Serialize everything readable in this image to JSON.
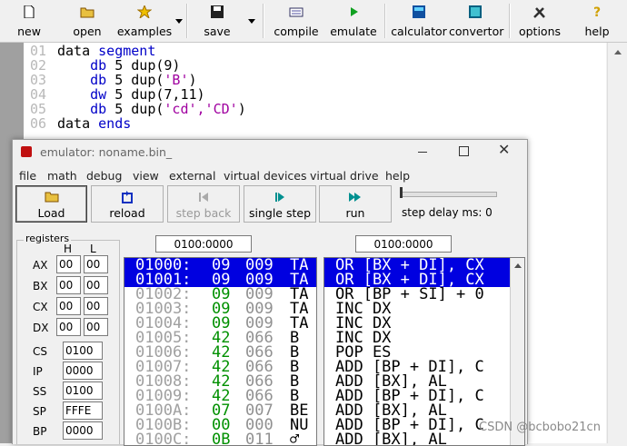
{
  "toolbar": {
    "new": "new",
    "open": "open",
    "examples": "examples",
    "save": "save",
    "compile": "compile",
    "emulate": "emulate",
    "calculator": "calculator",
    "convertor": "convertor",
    "options": "options",
    "help": "help"
  },
  "editor": {
    "line_numbers": [
      "01",
      "02",
      "03",
      "04",
      "05",
      "06"
    ],
    "lines": [
      {
        "a": "data ",
        "k": "segment",
        "b": "",
        "s": ""
      },
      {
        "a": "    ",
        "k": "db",
        "b": " 5 dup(9)",
        "s": ""
      },
      {
        "a": "    ",
        "k": "db",
        "b": " 5 dup(",
        "s": "'B'",
        "c": ")"
      },
      {
        "a": "    ",
        "k": "dw",
        "b": " 5 dup(7,11)",
        "s": ""
      },
      {
        "a": "    ",
        "k": "db",
        "b": " 5 dup(",
        "s": "'cd','CD'",
        "c": ")"
      },
      {
        "a": "data ",
        "k": "ends",
        "b": "",
        "s": ""
      }
    ]
  },
  "emulator": {
    "title": "emulator: noname.bin_",
    "menu": [
      "file",
      "math",
      "debug",
      "view",
      "external",
      "virtual devices",
      "virtual drive",
      "help"
    ],
    "buttons": {
      "load": "Load",
      "reload": "reload",
      "step_back": "step back",
      "single_step": "single step",
      "run": "run"
    },
    "step_delay": "step delay ms: 0",
    "registers_label": "registers",
    "h_label": "H",
    "l_label": "L",
    "regs8": [
      {
        "name": "AX",
        "h": "00",
        "l": "00"
      },
      {
        "name": "BX",
        "h": "00",
        "l": "00"
      },
      {
        "name": "CX",
        "h": "00",
        "l": "00"
      },
      {
        "name": "DX",
        "h": "00",
        "l": "00"
      }
    ],
    "regs16": [
      {
        "name": "CS",
        "v": "0100"
      },
      {
        "name": "IP",
        "v": "0000"
      },
      {
        "name": "SS",
        "v": "0100"
      },
      {
        "name": "SP",
        "v": "FFFE"
      },
      {
        "name": "BP",
        "v": "0000"
      }
    ],
    "mem_addr": "0100:0000",
    "dis_addr": "0100:0000",
    "memory": [
      {
        "a": "01000:",
        "h": "09",
        "d": "009",
        "c": "TA"
      },
      {
        "a": "01001:",
        "h": "09",
        "d": "009",
        "c": "TA"
      },
      {
        "a": "01002:",
        "h": "09",
        "d": "009",
        "c": "TA"
      },
      {
        "a": "01003:",
        "h": "09",
        "d": "009",
        "c": "TA"
      },
      {
        "a": "01004:",
        "h": "09",
        "d": "009",
        "c": "TA"
      },
      {
        "a": "01005:",
        "h": "42",
        "d": "066",
        "c": "B"
      },
      {
        "a": "01006:",
        "h": "42",
        "d": "066",
        "c": "B"
      },
      {
        "a": "01007:",
        "h": "42",
        "d": "066",
        "c": "B"
      },
      {
        "a": "01008:",
        "h": "42",
        "d": "066",
        "c": "B"
      },
      {
        "a": "01009:",
        "h": "42",
        "d": "066",
        "c": "B"
      },
      {
        "a": "0100A:",
        "h": "07",
        "d": "007",
        "c": "BE"
      },
      {
        "a": "0100B:",
        "h": "00",
        "d": "000",
        "c": "NU"
      },
      {
        "a": "0100C:",
        "h": "0B",
        "d": "011",
        "c": "♂"
      }
    ],
    "disasm": [
      "OR [BX + DI], CX",
      "OR [BX + DI], CX",
      "OR [BP + SI] + 0",
      "INC DX",
      "INC DX",
      "INC DX",
      "POP ES",
      "ADD [BP + DI], C",
      "ADD [BX], AL",
      "ADD [BP + DI], C",
      "ADD [BX], AL",
      "ADD [BP + DI], C",
      "ADD [BX], AL"
    ]
  },
  "watermark": "CSDN @bcbobo21cn"
}
